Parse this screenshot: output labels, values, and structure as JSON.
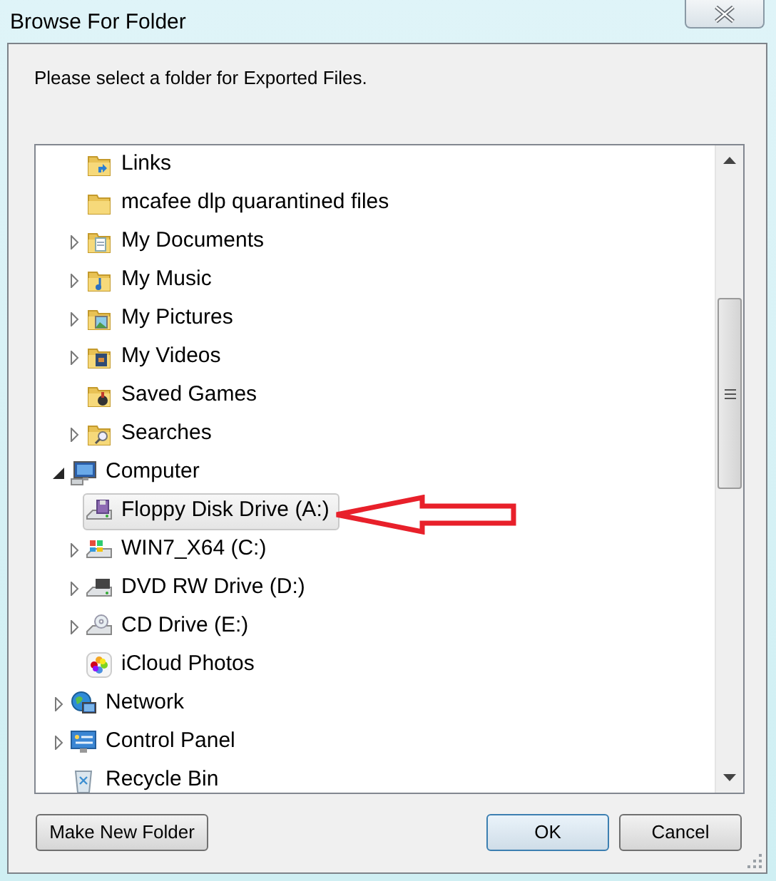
{
  "window": {
    "title": "Browse For Folder"
  },
  "prompt": "Please select a folder for Exported Files.",
  "tree": {
    "continued_items": [
      {
        "label": "Links",
        "kind": "folder-links",
        "has_children": false,
        "selected": false
      },
      {
        "label": "mcafee dlp quarantined files",
        "kind": "folder",
        "has_children": false,
        "selected": false
      },
      {
        "label": "My Documents",
        "kind": "folder-docs",
        "has_children": true,
        "expanded": false,
        "selected": false
      },
      {
        "label": "My Music",
        "kind": "folder-music",
        "has_children": true,
        "expanded": false,
        "selected": false
      },
      {
        "label": "My Pictures",
        "kind": "folder-pictures",
        "has_children": true,
        "expanded": false,
        "selected": false
      },
      {
        "label": "My Videos",
        "kind": "folder-videos",
        "has_children": true,
        "expanded": false,
        "selected": false
      },
      {
        "label": "Saved Games",
        "kind": "folder-games",
        "has_children": false,
        "selected": false
      },
      {
        "label": "Searches",
        "kind": "folder-search",
        "has_children": true,
        "expanded": false,
        "selected": false
      }
    ],
    "items": [
      {
        "label": "Computer",
        "kind": "computer",
        "has_children": true,
        "expanded": true,
        "selected": false,
        "children": [
          {
            "label": "Floppy Disk Drive (A:)",
            "kind": "floppy",
            "has_children": false,
            "selected": true
          },
          {
            "label": "WIN7_X64 (C:)",
            "kind": "drive-windows",
            "has_children": true,
            "expanded": false,
            "selected": false
          },
          {
            "label": "DVD RW Drive (D:)",
            "kind": "drive-dvd",
            "has_children": true,
            "expanded": false,
            "selected": false
          },
          {
            "label": "CD Drive (E:)",
            "kind": "drive-cd",
            "has_children": true,
            "expanded": false,
            "selected": false
          },
          {
            "label": "iCloud Photos",
            "kind": "photos",
            "has_children": false,
            "selected": false
          }
        ]
      },
      {
        "label": "Network",
        "kind": "network",
        "has_children": true,
        "expanded": false,
        "selected": false
      },
      {
        "label": "Control Panel",
        "kind": "control-panel",
        "has_children": true,
        "expanded": false,
        "selected": false
      },
      {
        "label": "Recycle Bin",
        "kind": "recycle-bin",
        "has_children": false,
        "selected": false
      }
    ]
  },
  "buttons": {
    "left": "Make New Folder",
    "ok": "OK",
    "cancel": "Cancel"
  }
}
